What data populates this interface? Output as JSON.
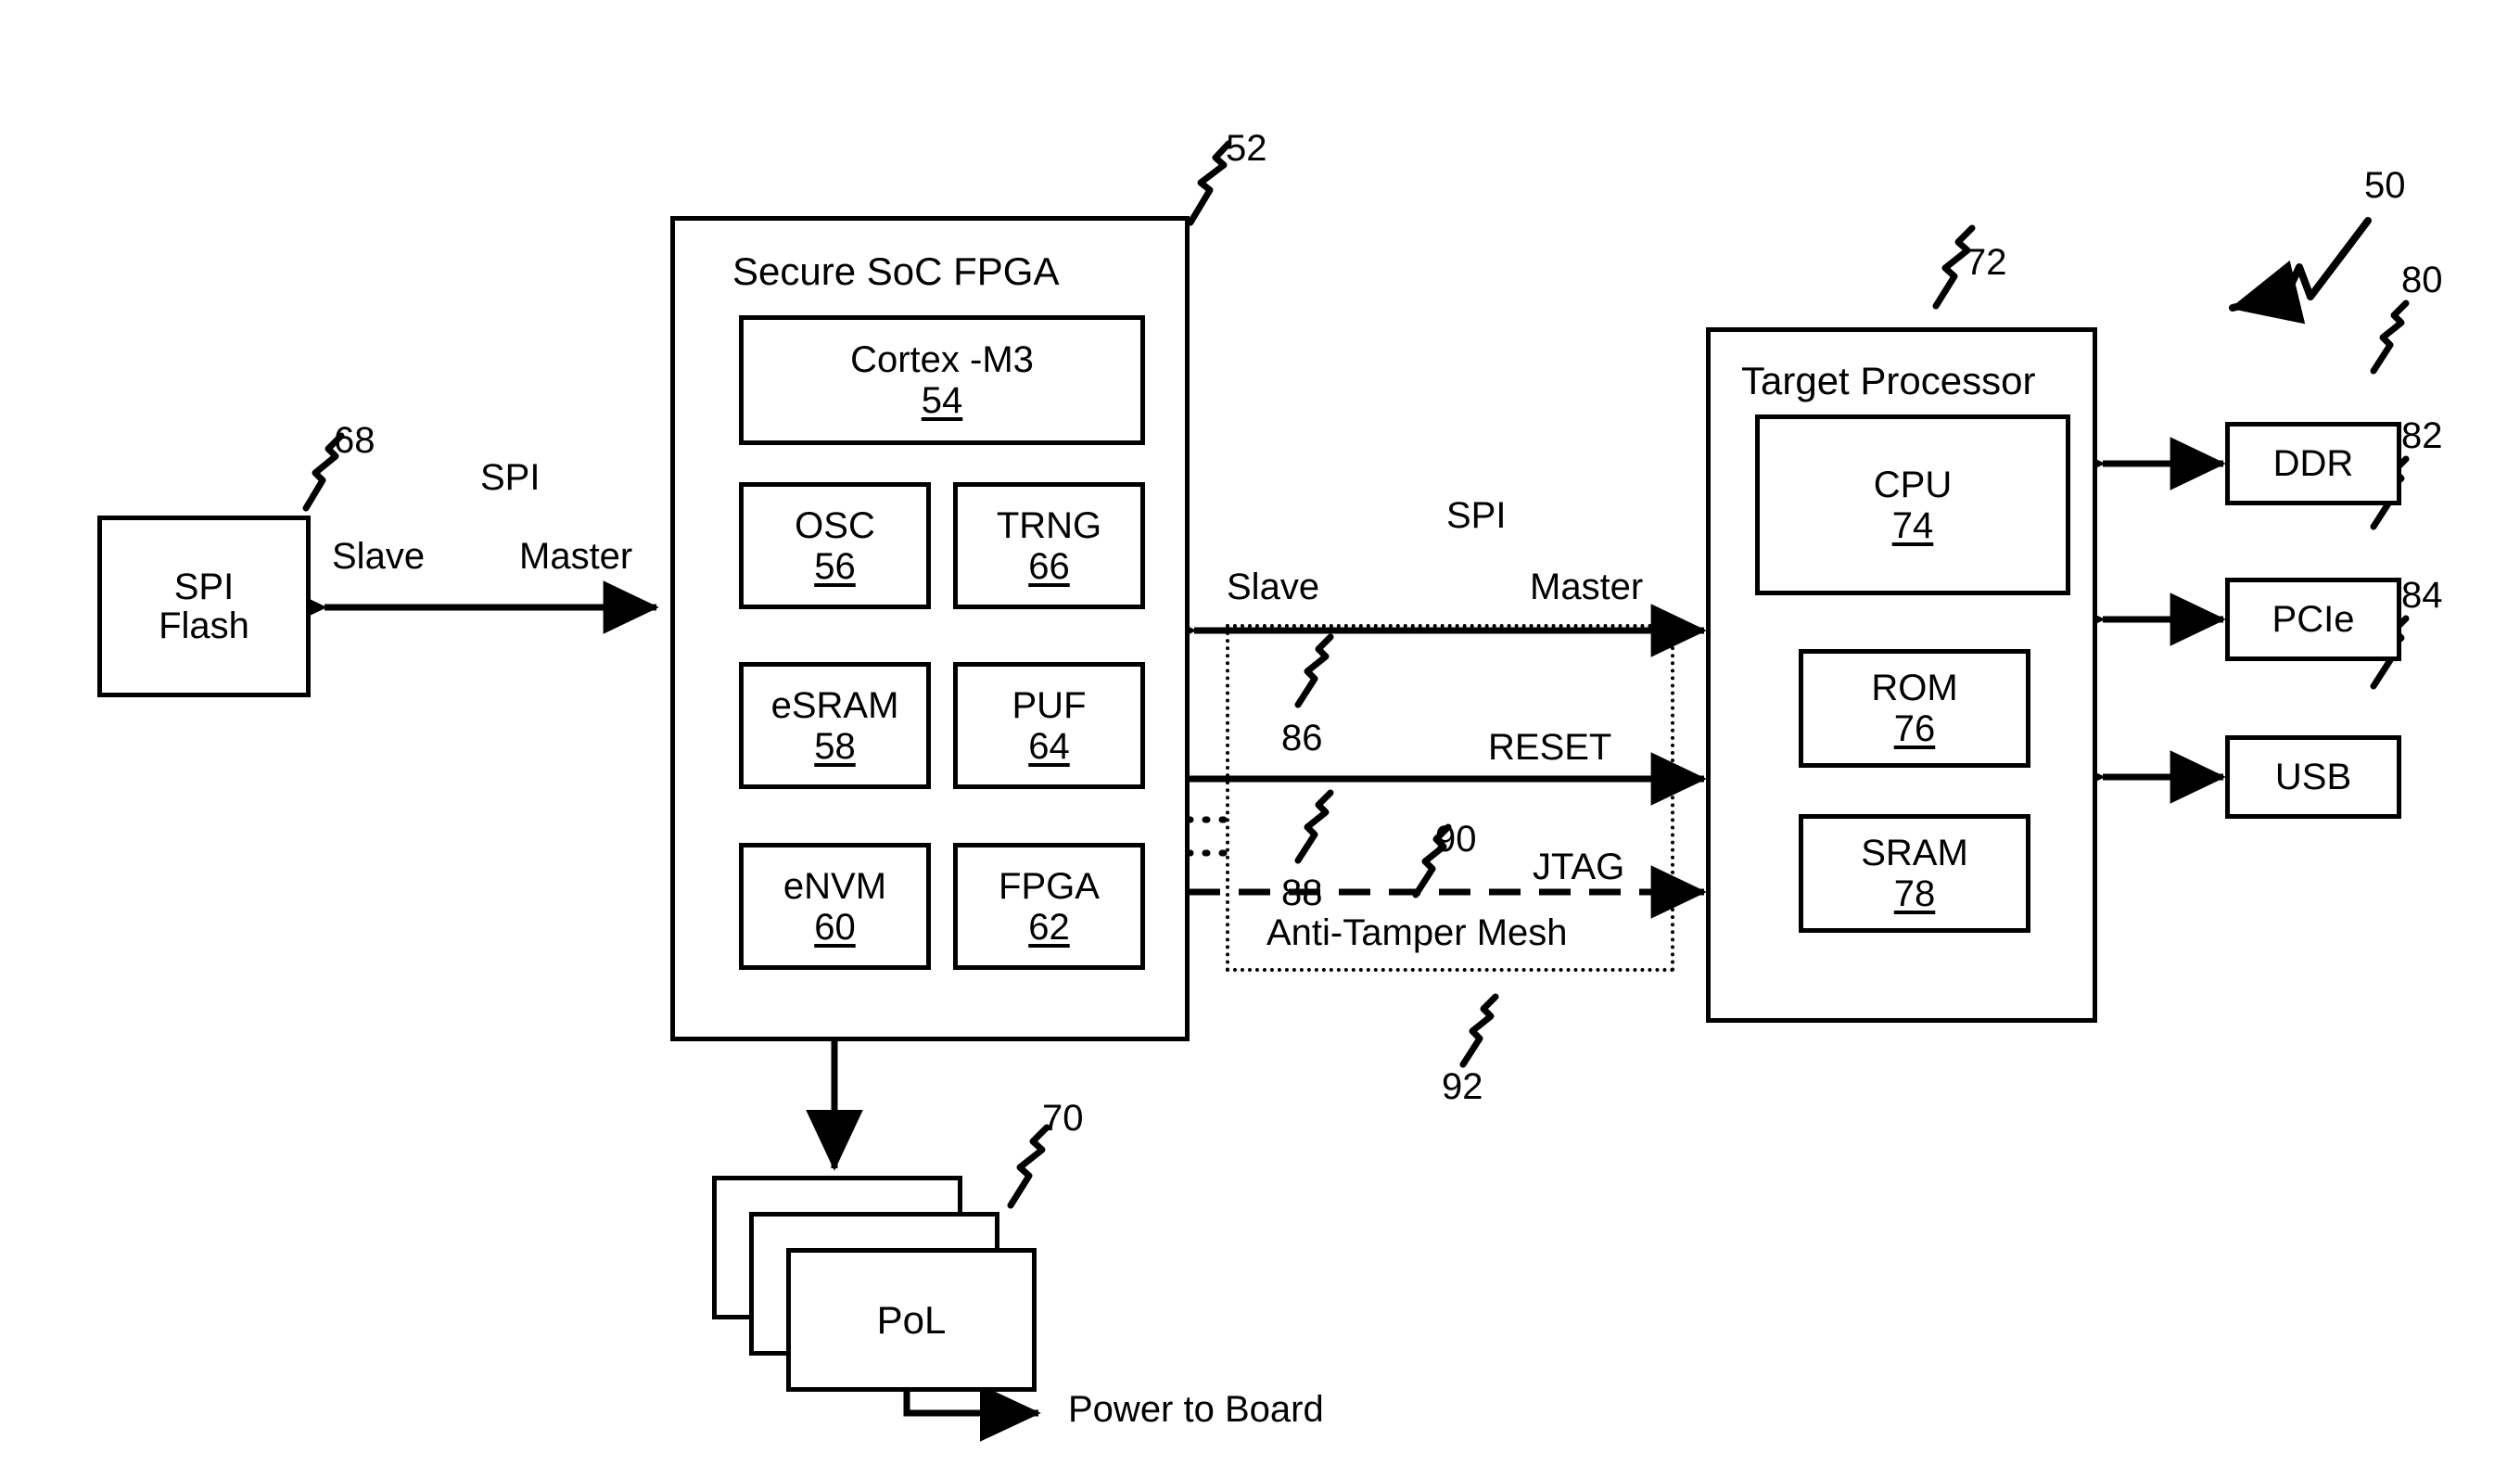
{
  "figure": {
    "system_ref": "50",
    "labels": {
      "spi_left": "SPI",
      "slave_left": "Slave",
      "master_left": "Master",
      "spi_mid": "SPI",
      "slave_mid": "Slave",
      "master_mid": "Master",
      "reset": "RESET",
      "jtag": "JTAG",
      "anti_tamper_mesh": "Anti-Tamper Mesh",
      "power_to_board": "Power to Board"
    },
    "ref_numbers": {
      "soc_fpga": "52",
      "spi_flash": "68",
      "pol": "70",
      "target_processor": "72",
      "ddr": "80",
      "pcie": "82",
      "usb": "84",
      "spi_link": "86",
      "reset_link": "88",
      "jtag_link": "90",
      "mesh": "92",
      "system": "50"
    }
  },
  "spi_flash": {
    "name_line1": "SPI",
    "name_line2": "Flash"
  },
  "soc_fpga": {
    "title": "Secure SoC FPGA",
    "blocks": [
      {
        "name": "Cortex -M3",
        "ref": "54"
      },
      {
        "name": "OSC",
        "ref": "56"
      },
      {
        "name": "TRNG",
        "ref": "66"
      },
      {
        "name": "eSRAM",
        "ref": "58"
      },
      {
        "name": "PUF",
        "ref": "64"
      },
      {
        "name": "eNVM",
        "ref": "60"
      },
      {
        "name": "FPGA",
        "ref": "62"
      }
    ]
  },
  "target_processor": {
    "title": "Target Processor",
    "blocks": [
      {
        "name": "CPU",
        "ref": "74"
      },
      {
        "name": "ROM",
        "ref": "76"
      },
      {
        "name": "SRAM",
        "ref": "78"
      }
    ]
  },
  "peripherals": [
    {
      "name": "DDR",
      "ref": "80"
    },
    {
      "name": "PCIe",
      "ref": "82"
    },
    {
      "name": "USB",
      "ref": "84"
    }
  ],
  "pol": {
    "name": "PoL",
    "ref": "70"
  },
  "colors": {
    "ink": "#000000",
    "paper": "#ffffff"
  }
}
